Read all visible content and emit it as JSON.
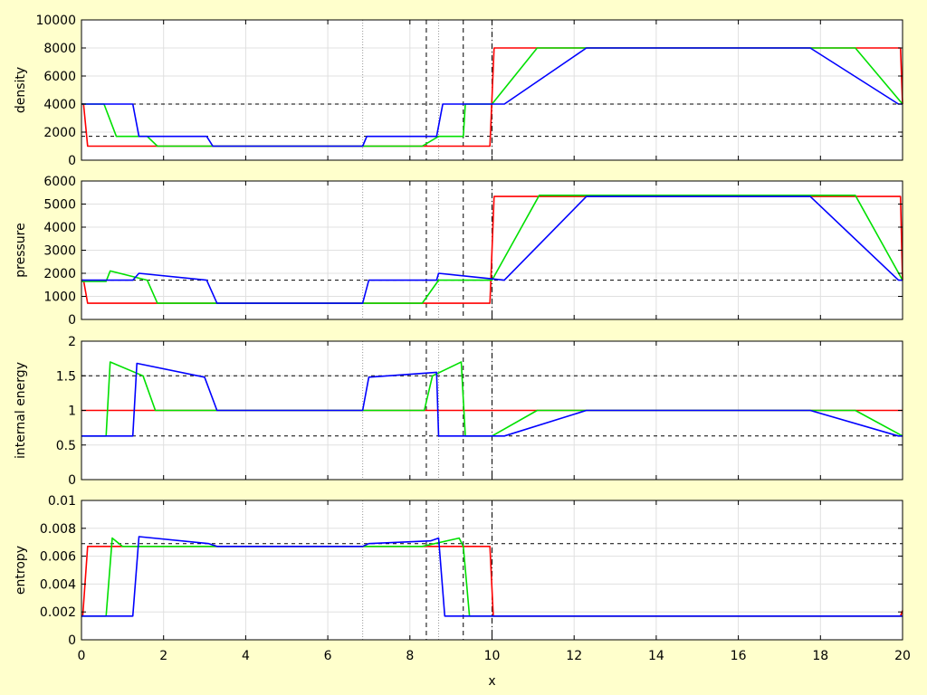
{
  "chart_data": {
    "type": "line",
    "xlabel": "x",
    "xlim": [
      0,
      20
    ],
    "xticks": [
      0,
      2,
      4,
      6,
      8,
      10,
      12,
      14,
      16,
      18,
      20
    ],
    "xtick_labels": [
      "0",
      "2",
      "4",
      "6",
      "8",
      "10",
      "12",
      "14",
      "16",
      "18",
      "20"
    ],
    "grid": true,
    "vertical_lines": [
      {
        "x": 6.85,
        "style": "dotted",
        "color": "#999999"
      },
      {
        "x": 8.4,
        "style": "dashed",
        "color": "#000000"
      },
      {
        "x": 8.7,
        "style": "dotted",
        "color": "#999999"
      },
      {
        "x": 9.3,
        "style": "dashed",
        "color": "#000000"
      },
      {
        "x": 10.0,
        "style": "dashdot",
        "color": "#000000"
      }
    ],
    "series_colors": {
      "red": "#ff0000",
      "green": "#00e000",
      "blue": "#0000ff"
    },
    "panels": [
      {
        "ylabel": "density",
        "ylim": [
          0,
          10000
        ],
        "yticks": [
          0,
          2000,
          4000,
          6000,
          8000,
          10000
        ],
        "ytick_labels": [
          "0",
          "2000",
          "4000",
          "6000",
          "8000",
          "10000"
        ],
        "hlines": [
          4000,
          1700
        ],
        "series": [
          {
            "color": "red",
            "x": [
              0,
              0.05,
              0.15,
              9.95,
              10.05,
              19.95,
              20
            ],
            "y": [
              4000,
              4000,
              1000,
              1000,
              8000,
              8000,
              4000
            ]
          },
          {
            "color": "green",
            "x": [
              0,
              0.55,
              0.85,
              1.6,
              1.85,
              8.3,
              8.7,
              9.3,
              9.35,
              10.0,
              11.1,
              18.85,
              20
            ],
            "y": [
              4000,
              4000,
              1700,
              1700,
              1000,
              1000,
              1700,
              1700,
              4000,
              4000,
              8000,
              8000,
              4000
            ]
          },
          {
            "color": "blue",
            "x": [
              0,
              1.25,
              1.4,
              3.05,
              3.2,
              6.85,
              6.95,
              8.65,
              8.8,
              10.3,
              12.3,
              17.75,
              19.9,
              20
            ],
            "y": [
              4000,
              4000,
              1700,
              1700,
              1000,
              1000,
              1700,
              1700,
              4000,
              4000,
              8000,
              8000,
              4000,
              4000
            ]
          }
        ]
      },
      {
        "ylabel": "pressure",
        "ylim": [
          0,
          6000
        ],
        "yticks": [
          0,
          1000,
          2000,
          3000,
          4000,
          5000,
          6000
        ],
        "ytick_labels": [
          "0",
          "1000",
          "2000",
          "3000",
          "4000",
          "5000",
          "6000"
        ],
        "hlines": [
          1700
        ],
        "series": [
          {
            "color": "red",
            "x": [
              0,
              0.05,
              0.15,
              9.95,
              10.05,
              19.95,
              20
            ],
            "y": [
              1700,
              1700,
              700,
              700,
              5330,
              5330,
              1700
            ]
          },
          {
            "color": "green",
            "x": [
              0,
              0.6,
              0.7,
              1.6,
              1.85,
              8.3,
              8.7,
              9.3,
              9.35,
              10.0,
              11.15,
              18.85,
              20
            ],
            "y": [
              1650,
              1650,
              2100,
              1700,
              700,
              700,
              1700,
              1700,
              1700,
              1700,
              5380,
              5380,
              1700
            ]
          },
          {
            "color": "blue",
            "x": [
              0,
              1.25,
              1.4,
              3.05,
              3.3,
              6.85,
              7.0,
              8.65,
              8.7,
              10.3,
              12.3,
              17.75,
              19.9,
              20
            ],
            "y": [
              1700,
              1700,
              2000,
              1700,
              700,
              700,
              1700,
              1700,
              2000,
              1700,
              5330,
              5330,
              1700,
              1700
            ]
          }
        ]
      },
      {
        "ylabel": "internal energy",
        "ylim": [
          0,
          2
        ],
        "yticks": [
          0,
          0.5,
          1,
          1.5,
          2
        ],
        "ytick_labels": [
          "0",
          "0.5",
          "1",
          "1.5",
          "2"
        ],
        "hlines": [
          1.5,
          0.63
        ],
        "series": [
          {
            "color": "red",
            "x": [
              0,
              20
            ],
            "y": [
              1.0,
              1.0
            ]
          },
          {
            "color": "green",
            "x": [
              0,
              0.6,
              0.7,
              1.5,
              1.8,
              8.35,
              8.55,
              9.25,
              9.35,
              10.0,
              11.1,
              18.85,
              20
            ],
            "y": [
              0.63,
              0.63,
              1.7,
              1.5,
              1.0,
              1.0,
              1.5,
              1.7,
              0.63,
              0.63,
              1.0,
              1.0,
              0.63
            ]
          },
          {
            "color": "blue",
            "x": [
              0,
              1.25,
              1.35,
              3.0,
              3.3,
              6.85,
              7.0,
              8.65,
              8.7,
              10.3,
              12.3,
              17.75,
              19.9,
              20
            ],
            "y": [
              0.63,
              0.63,
              1.68,
              1.48,
              1.0,
              1.0,
              1.48,
              1.55,
              0.63,
              0.63,
              1.0,
              1.0,
              0.63,
              0.63
            ]
          }
        ]
      },
      {
        "ylabel": "entropy",
        "ylim": [
          0,
          0.01
        ],
        "yticks": [
          0,
          0.002,
          0.004,
          0.006,
          0.008,
          0.01
        ],
        "ytick_labels": [
          "0",
          "0.002",
          "0.004",
          "0.006",
          "0.008",
          "0.01"
        ],
        "hlines": [
          0.0069
        ],
        "series": [
          {
            "color": "red",
            "x": [
              0,
              0.03,
              0.15,
              9.95,
              10.03,
              19.95,
              20
            ],
            "y": [
              0.0017,
              0.0017,
              0.0067,
              0.0067,
              0.0017,
              0.0017,
              0.0021
            ]
          },
          {
            "color": "green",
            "x": [
              0,
              0.6,
              0.75,
              1.0,
              8.3,
              9.2,
              9.3,
              9.45,
              20
            ],
            "y": [
              0.0017,
              0.0017,
              0.0073,
              0.0067,
              0.0067,
              0.0073,
              0.0067,
              0.0017,
              0.0017
            ]
          },
          {
            "color": "blue",
            "x": [
              0,
              1.25,
              1.4,
              3.1,
              3.3,
              6.85,
              7.0,
              8.5,
              8.7,
              8.85,
              20
            ],
            "y": [
              0.0017,
              0.0017,
              0.0074,
              0.0069,
              0.0067,
              0.0067,
              0.0069,
              0.0071,
              0.0073,
              0.0017,
              0.0017
            ]
          }
        ]
      }
    ]
  }
}
